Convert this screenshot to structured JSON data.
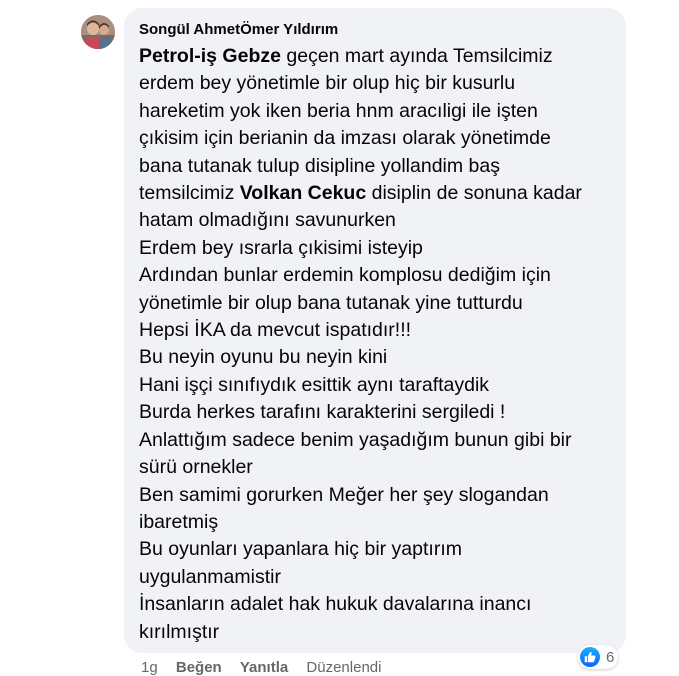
{
  "comment": {
    "author": "Songül AhmetÖmer Yıldırım",
    "lines": [
      {
        "mention": "Petrol-iş Gebze",
        "text": " geçen mart ayında Temsilcimiz"
      },
      {
        "text": "erdem bey yönetimle bir olup hiç bir kusurlu"
      },
      {
        "text": "hareketim yok iken beria hnm aracıligi ile işten"
      },
      {
        "text": "çıkisim için berianin da imzası olarak yönetimde"
      },
      {
        "text": "bana tutanak tulup disipline yollandim baş"
      },
      {
        "pre": "temsilcimiz ",
        "mention": "Volkan Cekuc",
        "text": " disiplin de sonuna kadar"
      },
      {
        "text": "hatam olmadığını savunurken"
      },
      {
        "text": "Erdem bey ısrarla çıkisimi isteyip"
      },
      {
        "text": "Ardından bunlar erdemin komplosu dediğim için"
      },
      {
        "text": "yönetimle bir olup bana tutanak yine tutturdu"
      },
      {
        "text": "Hepsi İKA da mevcut ispatıdır!!!"
      },
      {
        "text": "Bu neyin oyunu bu neyin kini"
      },
      {
        "text": "Hani işçi sınıfıydık esittik aynı taraftaydik"
      },
      {
        "text": "Burda herkes tarafını karakterini sergiledi !"
      },
      {
        "text": "Anlattığım sadece benim yaşadığım bunun gibi bir"
      },
      {
        "text": "sürü ornekler"
      },
      {
        "text": "Ben samimi gorurken Meğer her şey slogandan"
      },
      {
        "text": "ibaretmiş"
      },
      {
        "text": "Bu oyunları yapanlara hiç bir yaptırım"
      },
      {
        "text": "uygulanmamistir"
      },
      {
        "text": "İnsanların adalet hak hukuk davalarına inancı"
      },
      {
        "text": "kırılmıştır"
      }
    ]
  },
  "actions": {
    "time": "1g",
    "like": "Beğen",
    "reply": "Yanıtla",
    "edited": "Düzenlendi"
  },
  "reactions": {
    "icon": "like-icon",
    "count": "6",
    "color": "#0866ff"
  }
}
